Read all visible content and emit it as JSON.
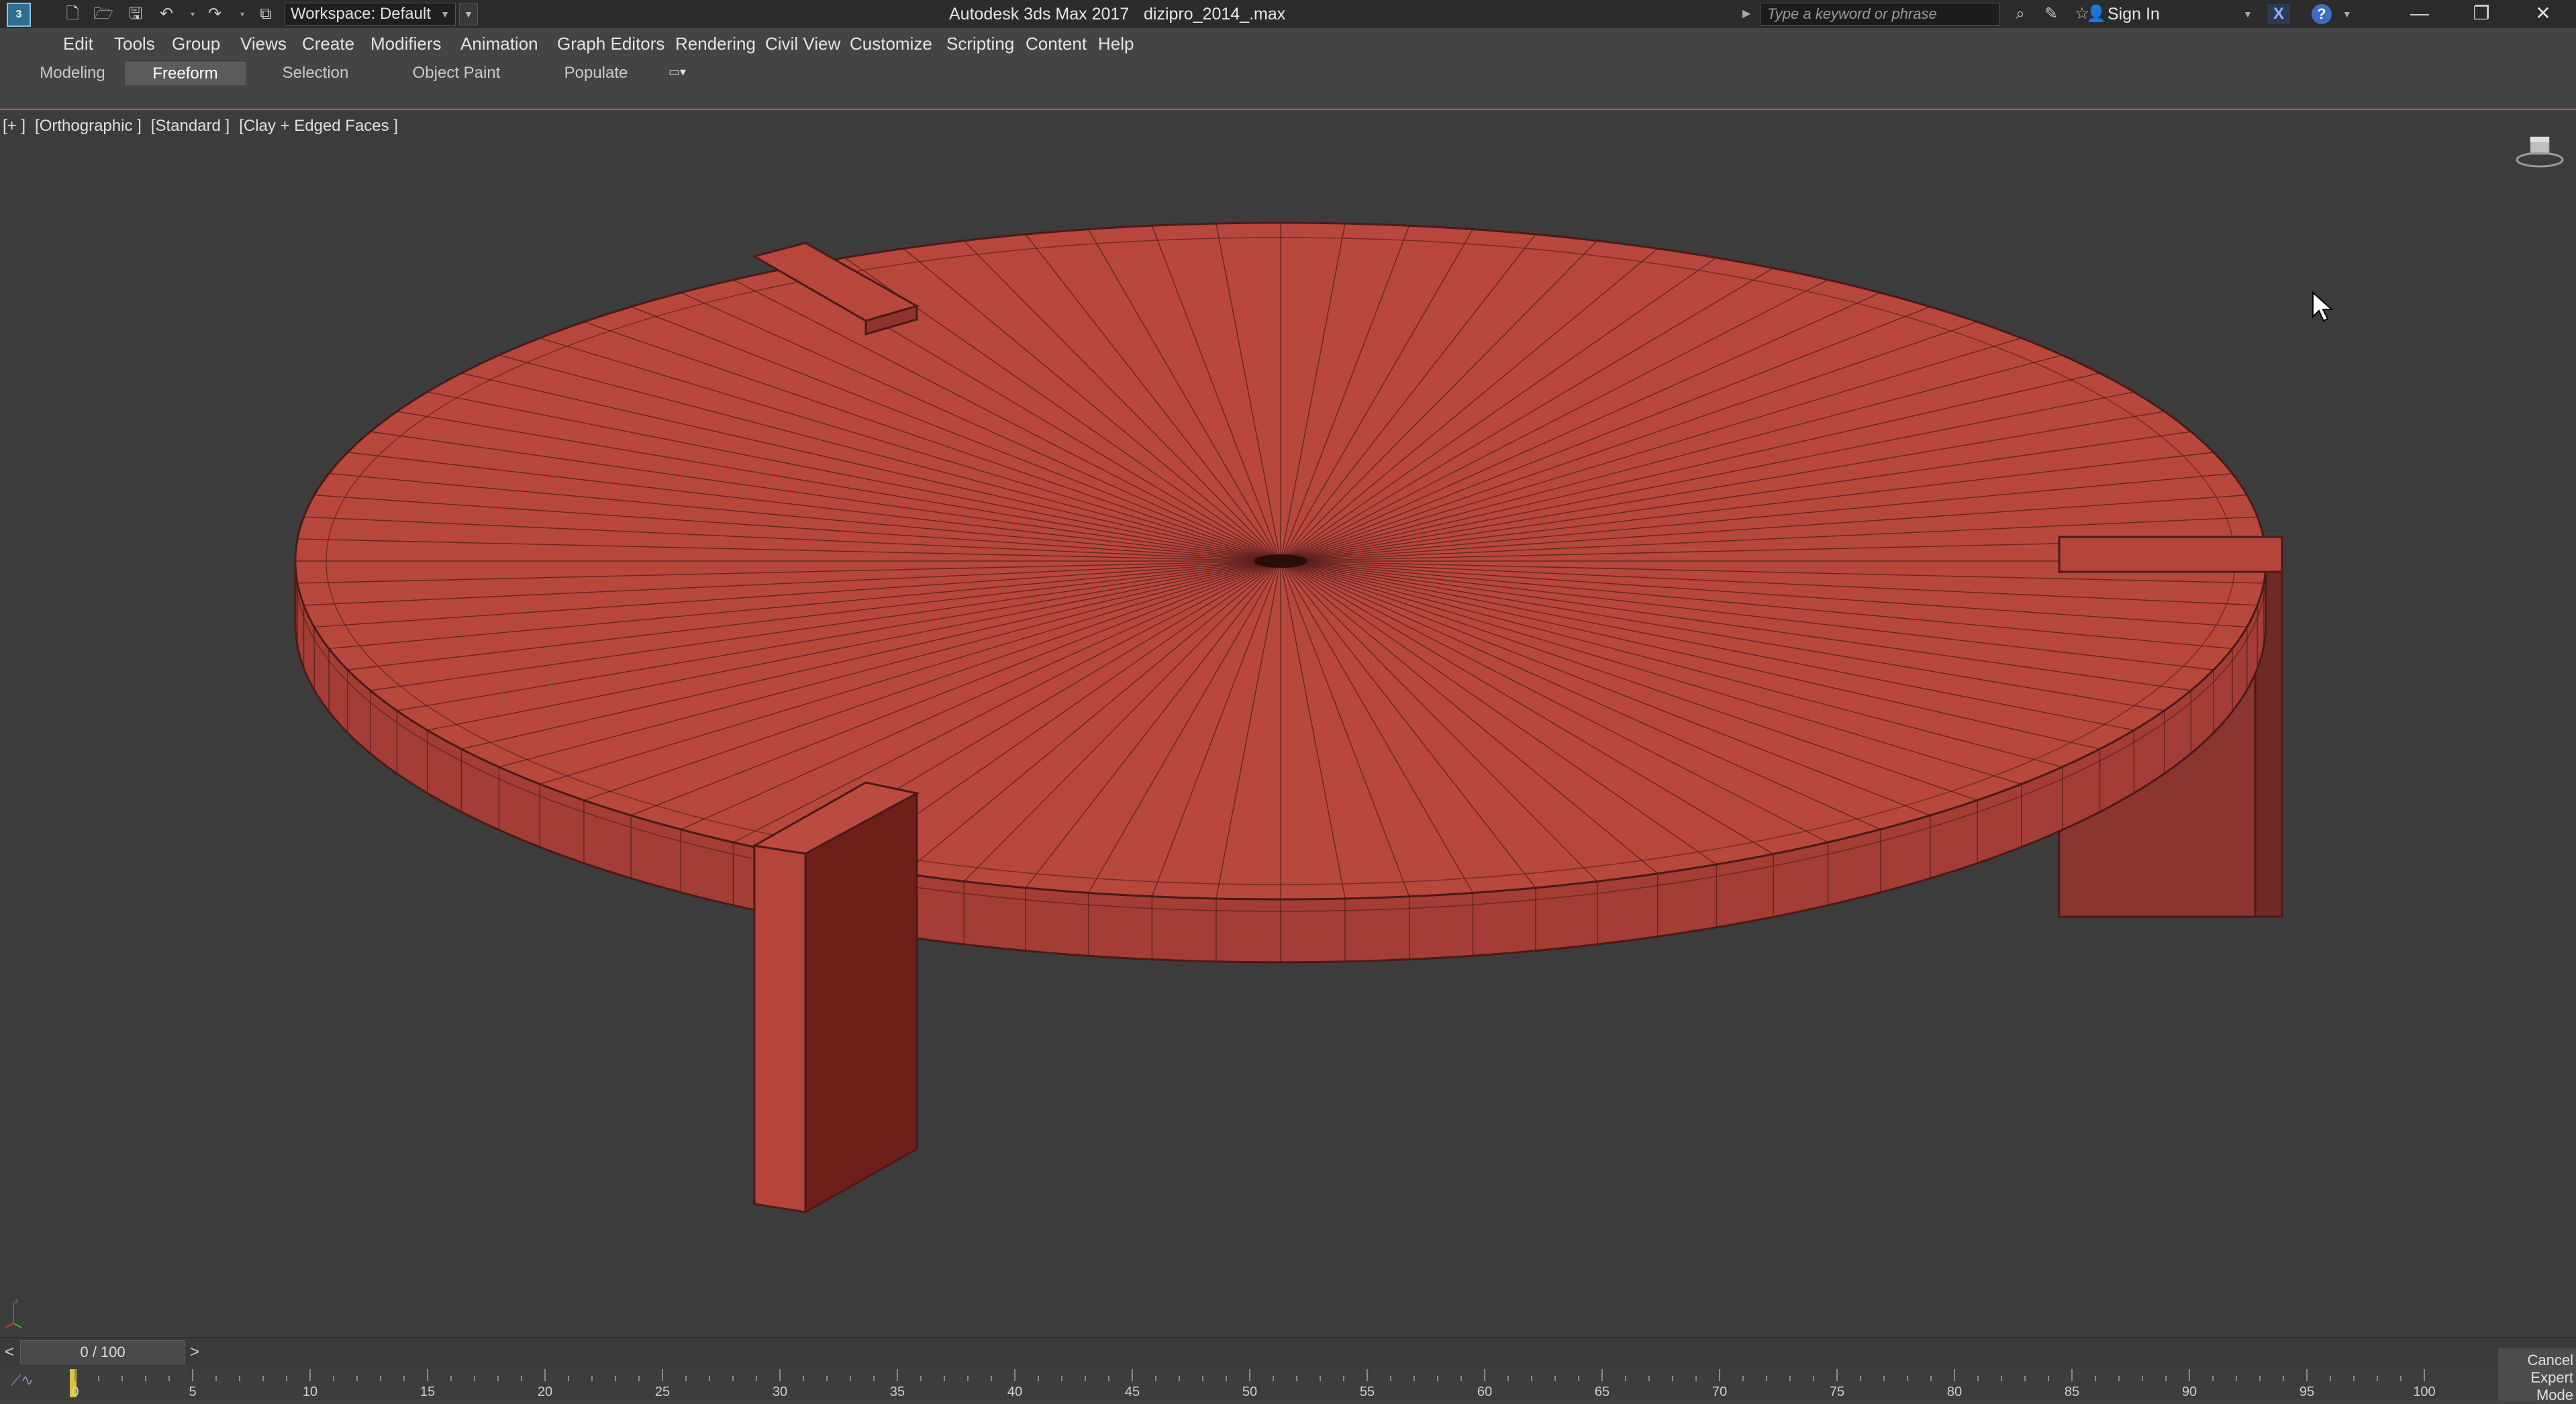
{
  "app": {
    "title": "Autodesk 3ds Max 2017",
    "file": "dizipro_2014_.max",
    "icon_label": "3"
  },
  "quick_access": {
    "workspace_value": "Workspace: Default",
    "icons": [
      "new-file-icon",
      "open-folder-icon",
      "save-icon",
      "undo-icon",
      "redo-icon",
      "project-folder-icon"
    ]
  },
  "search": {
    "placeholder": "Type a keyword or phrase"
  },
  "account": {
    "sign_in": "Sign In"
  },
  "window_controls": {
    "minimize": "—",
    "restore": "❐",
    "close": "✕"
  },
  "menu": [
    "Edit",
    "Tools",
    "Group",
    "Views",
    "Create",
    "Modifiers",
    "Animation",
    "Graph Editors",
    "Rendering",
    "Civil View",
    "Customize",
    "Scripting",
    "Content",
    "Help"
  ],
  "ribbon_tabs": [
    {
      "label": "Modeling",
      "active": false
    },
    {
      "label": "Freeform",
      "active": true
    },
    {
      "label": "Selection",
      "active": false
    },
    {
      "label": "Object Paint",
      "active": false
    },
    {
      "label": "Populate",
      "active": false
    }
  ],
  "viewport": {
    "label_plus": "[+ ]",
    "label_view": "[Orthographic ]",
    "label_shading": "[Standard ]",
    "label_style": "[Clay + Edged Faces ]",
    "object_color": "#b8473e",
    "edge_color": "#4a1a16",
    "background_color": "#3c3c3c"
  },
  "time_slider": {
    "value": "0 / 100",
    "prev_label": "<",
    "next_label": ">",
    "current_frame": 0,
    "total_frames": 100
  },
  "track_bar": {
    "ticks": [
      "0",
      "5",
      "10",
      "15",
      "20",
      "25",
      "30",
      "35",
      "40",
      "45",
      "50",
      "55",
      "60",
      "65",
      "70",
      "75",
      "80",
      "85",
      "90",
      "95",
      "100"
    ]
  },
  "status": {
    "cancel_expert_line1": "Cancel",
    "cancel_expert_line2": "Expert Mode"
  }
}
